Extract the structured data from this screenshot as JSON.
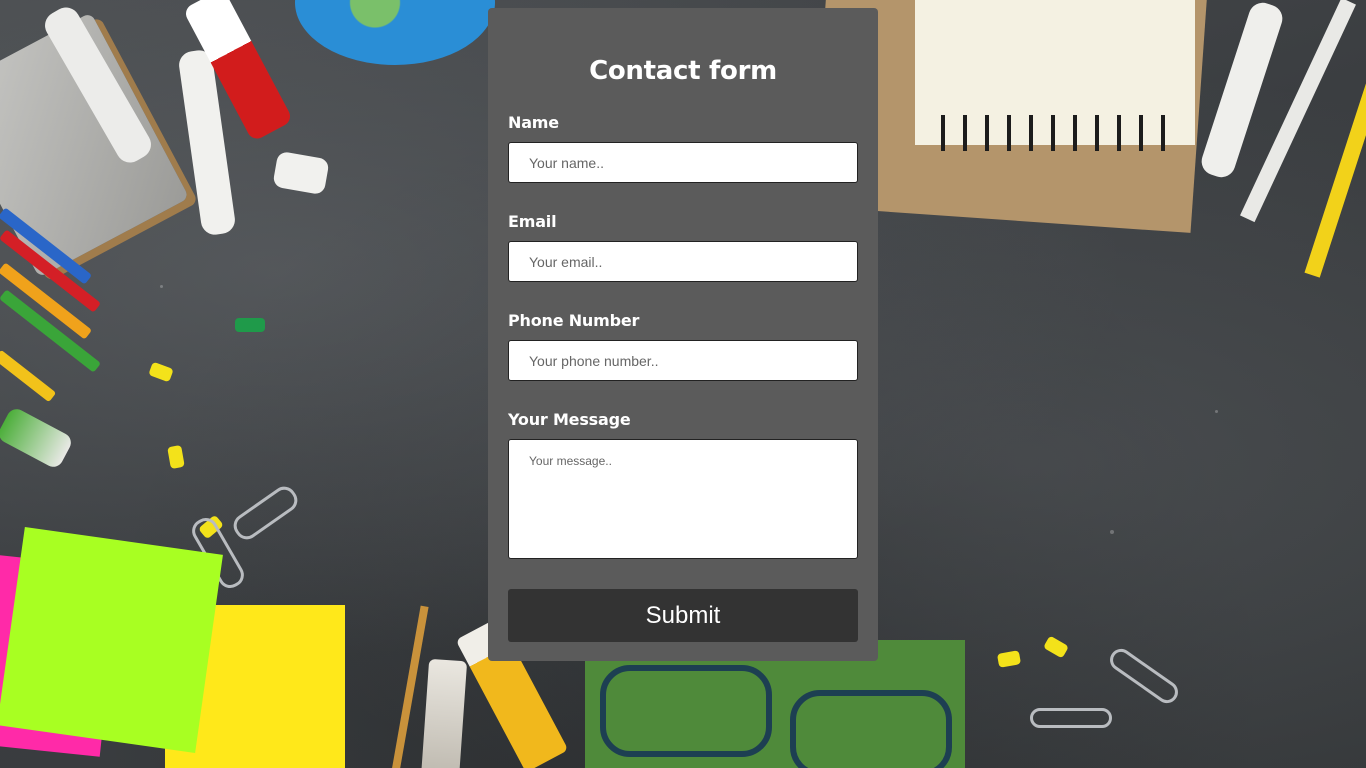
{
  "form": {
    "title": "Contact form",
    "fields": [
      {
        "label": "Name",
        "placeholder": "Your name..",
        "value": ""
      },
      {
        "label": "Email",
        "placeholder": "Your email..",
        "value": ""
      },
      {
        "label": "Phone Number",
        "placeholder": "Your phone number..",
        "value": ""
      },
      {
        "label": "Your Message",
        "placeholder": "Your message..",
        "value": ""
      }
    ],
    "submit_label": "Submit"
  },
  "colors": {
    "card_background": "#5b5b5b",
    "submit_background": "#333333",
    "text": "#ffffff"
  }
}
